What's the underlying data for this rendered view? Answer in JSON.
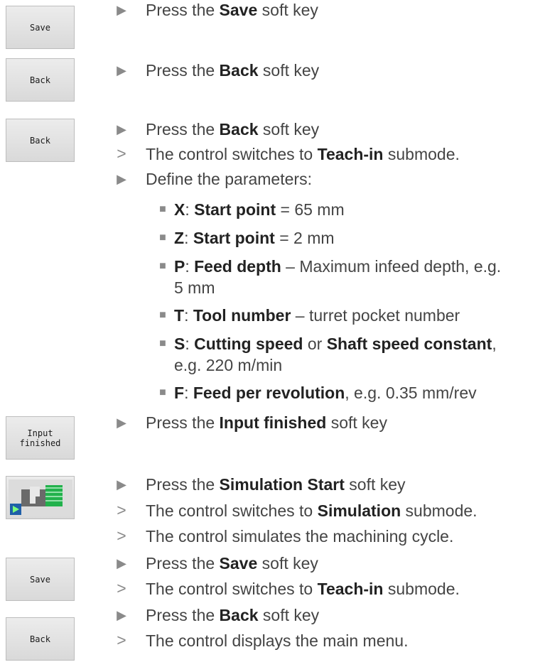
{
  "softkeys": {
    "k1": "Save",
    "k2": "Back",
    "k3": "Back",
    "k4": "Input\nfinished",
    "k6": "Save",
    "k7": "Back"
  },
  "bullets": {
    "action": "▶",
    "result": ">",
    "sub": "■"
  },
  "steps": {
    "s1": {
      "a": "Press the ",
      "b": "Save",
      "c": " soft key"
    },
    "s2": {
      "a": "Press the ",
      "b": "Back",
      "c": " soft key"
    },
    "s3": {
      "a": "Press the ",
      "b": "Back",
      "c": " soft key"
    },
    "r3": {
      "a": "The control switches to ",
      "b": "Teach-in",
      "c": " submode."
    },
    "def": "Define the parameters:",
    "p1": {
      "k": "X",
      ":": ":",
      "n": "Start point",
      "v": " = 65 mm"
    },
    "p2": {
      "k": "Z",
      "n": "Start point",
      "v": " = 2 mm"
    },
    "p3": {
      "k": "P",
      "n": "Feed depth",
      "v": " – Maximum infeed depth, e.g.",
      "v2": "5 mm"
    },
    "p4": {
      "k": "T",
      "n": "Tool number",
      "v": " – turret pocket number"
    },
    "p5": {
      "k": "S",
      "n": "Cutting speed",
      "mid": " or ",
      "n2": "Shaft speed constant",
      "end": ",",
      "v2": "e.g. 220 m/min"
    },
    "p6": {
      "k": "F",
      "n": "Feed per revolution",
      "v": ", e.g. 0.35 mm/rev"
    },
    "s4": {
      "a": "Press the ",
      "b": "Input finished",
      "c": " soft key"
    },
    "s5": {
      "a": "Press the ",
      "b": "Simulation Start",
      "c": " soft key"
    },
    "r5a": {
      "a": "The control switches to ",
      "b": "Simulation",
      "c": " submode."
    },
    "r5b": "The control simulates the machining cycle.",
    "s6": {
      "a": "Press the ",
      "b": "Save",
      "c": " soft key"
    },
    "r6": {
      "a": "The control switches to ",
      "b": "Teach-in",
      "c": " submode."
    },
    "s7": {
      "a": "Press the ",
      "b": "Back",
      "c": " soft key"
    },
    "r7": "The control displays the main menu."
  },
  "colors": {
    "sim_icon_green": "#22b14c",
    "sim_icon_blue": "#1f5fa8"
  }
}
